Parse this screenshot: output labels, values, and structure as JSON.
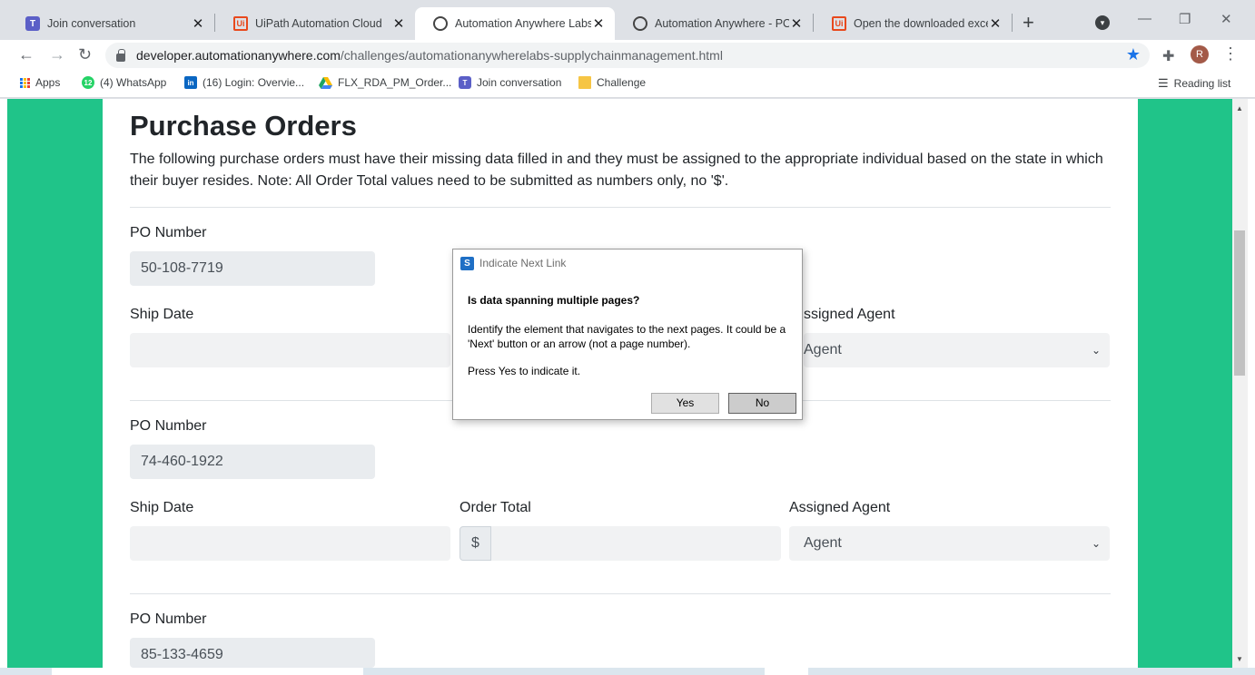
{
  "browser": {
    "tabs": [
      {
        "title": "Join conversation",
        "icon": "teams-icon",
        "active": false
      },
      {
        "title": "UiPath Automation Cloud",
        "icon": "uipath-icon",
        "active": false
      },
      {
        "title": "Automation Anywhere Labs - ",
        "icon": "globe-icon",
        "active": true
      },
      {
        "title": "Automation Anywhere - PO T",
        "icon": "globe-icon",
        "active": false
      },
      {
        "title": "Open the downloaded excel (",
        "icon": "uipath-icon",
        "active": false
      }
    ],
    "url_host": "developer.automationanywhere.com",
    "url_path": "/challenges/automationanywherelabs-supplychainmanagement.html",
    "profile_initial": "R",
    "bookmarks": [
      {
        "label": "Apps",
        "icon": "apps-grid-icon"
      },
      {
        "label": "(4) WhatsApp",
        "icon": "whatsapp-icon",
        "badge": "12"
      },
      {
        "label": "(16) Login: Overvie...",
        "icon": "linkedin-icon"
      },
      {
        "label": "FLX_RDA_PM_Order...",
        "icon": "google-drive-icon"
      },
      {
        "label": "Join conversation",
        "icon": "teams-icon"
      },
      {
        "label": "Challenge",
        "icon": "folder-icon"
      }
    ],
    "reading_list": "Reading list"
  },
  "page": {
    "title": "Purchase Orders",
    "intro": "The following purchase orders must have their missing data filled in and they must be assigned to the appropriate individual based on the state in which their buyer resides. Note: All Order Total values need to be submitted as numbers only, no '$'.",
    "labels": {
      "po_number": "PO Number",
      "ship_date": "Ship Date",
      "order_total": "Order Total",
      "assigned_agent": "Assigned Agent",
      "assigned_agent_partial": "ssigned Agent",
      "currency": "$",
      "agent_placeholder": "Agent"
    },
    "orders": [
      {
        "po_number": "50-108-7719"
      },
      {
        "po_number": "74-460-1922"
      },
      {
        "po_number": "85-133-4659"
      }
    ]
  },
  "dialog": {
    "title": "Indicate Next Link",
    "question": "Is data spanning multiple pages?",
    "body": "Identify the element that navigates to the next pages. It could be a 'Next' button or an arrow (not a page number).",
    "prompt": "Press Yes to indicate it.",
    "yes_label": "Yes",
    "no_label": "No"
  },
  "colors": {
    "accent_green": "#20c489",
    "field_bg": "#e9ecef"
  }
}
